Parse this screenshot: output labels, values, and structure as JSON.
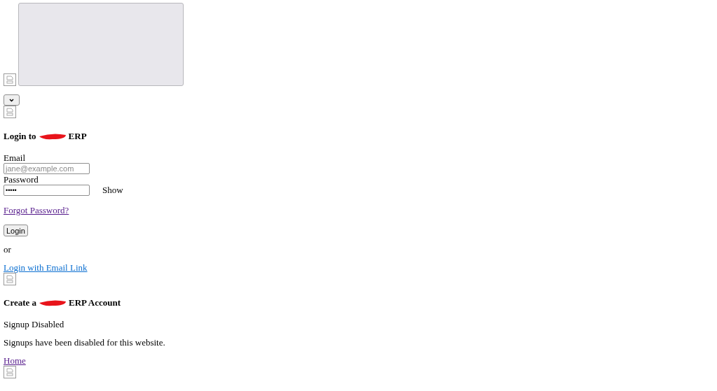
{
  "login": {
    "heading_before": "Login to",
    "heading_after": "ERP",
    "email": {
      "label": "Email",
      "placeholder": "jane@example.com"
    },
    "password": {
      "label": "Password",
      "value": "•••••",
      "toggle": "Show"
    },
    "forgot_link": {
      "label": "Forgot Password?",
      "visited": true
    },
    "login_button": "Login",
    "separator": "or",
    "email_link": {
      "label": "Login with Email Link",
      "visited": false
    }
  },
  "signup": {
    "heading_before": "Create a",
    "heading_after": "ERP Account",
    "status": "Signup Disabled",
    "message": "Signups have been disabled for this website.",
    "home_link": {
      "label": "Home",
      "visited": true
    }
  }
}
